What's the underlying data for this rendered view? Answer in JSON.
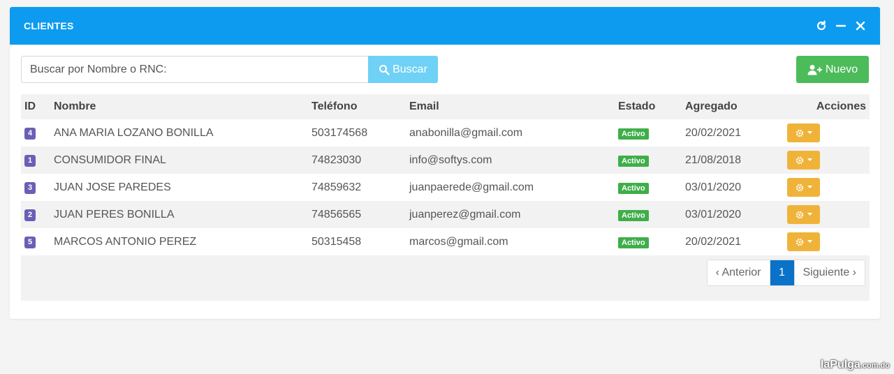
{
  "header": {
    "title": "CLIENTES",
    "tools": [
      "refresh-icon",
      "minimize-icon",
      "close-icon"
    ]
  },
  "search": {
    "placeholder": "Buscar por Nombre o RNC:",
    "value": "",
    "button_label": "Buscar"
  },
  "new_button": {
    "label": "Nuevo"
  },
  "table": {
    "columns": [
      "ID",
      "Nombre",
      "Teléfono",
      "Email",
      "Estado",
      "Agregado",
      "Acciones"
    ],
    "rows": [
      {
        "id": "4",
        "nombre": "ANA MARIA LOZANO BONILLA",
        "telefono": "503174568",
        "email": "anabonilla@gmail.com",
        "estado": "Activo",
        "agregado": "20/02/2021"
      },
      {
        "id": "1",
        "nombre": "CONSUMIDOR FINAL",
        "telefono": "74823030",
        "email": "info@softys.com",
        "estado": "Activo",
        "agregado": "21/08/2018"
      },
      {
        "id": "3",
        "nombre": "JUAN JOSE PAREDES",
        "telefono": "74859632",
        "email": "juanpaerede@gmail.com",
        "estado": "Activo",
        "agregado": "03/01/2020"
      },
      {
        "id": "2",
        "nombre": "JUAN PERES BONILLA",
        "telefono": "74856565",
        "email": "juanperez@gmail.com",
        "estado": "Activo",
        "agregado": "03/01/2020"
      },
      {
        "id": "5",
        "nombre": "MARCOS ANTONIO PEREZ",
        "telefono": "50315458",
        "email": "marcos@gmail.com",
        "estado": "Activo",
        "agregado": "20/02/2021"
      }
    ]
  },
  "pagination": {
    "prev_label": "‹ Anterior",
    "current_page": "1",
    "next_label": "Siguiente ›"
  },
  "watermark": {
    "brand": "laPulga",
    "suffix": ".com.do"
  },
  "colors": {
    "header": "#0d9bf0",
    "search_button": "#6fd1f5",
    "new_button": "#4cbb5a",
    "id_badge": "#6a5fb6",
    "status_badge": "#3fae49",
    "action_button": "#f0b33a",
    "active_page": "#0a72c9"
  }
}
